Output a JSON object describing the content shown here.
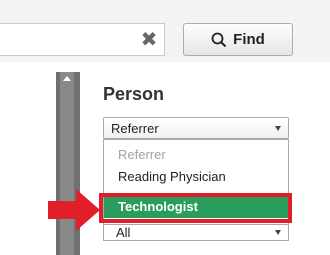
{
  "search": {
    "value": "",
    "clear_icon": "close-icon",
    "find_label": "Find",
    "find_icon": "search-icon"
  },
  "panel": {
    "title": "Person",
    "person_select": {
      "value": "Referrer",
      "options": [
        {
          "label": "Referrer",
          "state": "disabled"
        },
        {
          "label": "Reading Physician",
          "state": "normal"
        },
        {
          "label": "Technologist",
          "state": "selected"
        }
      ]
    },
    "second_select": {
      "value": "All"
    }
  },
  "colors": {
    "selected_option": "#2a9d5c",
    "highlight": "#e01f2a",
    "scrollbar": "#898989"
  }
}
